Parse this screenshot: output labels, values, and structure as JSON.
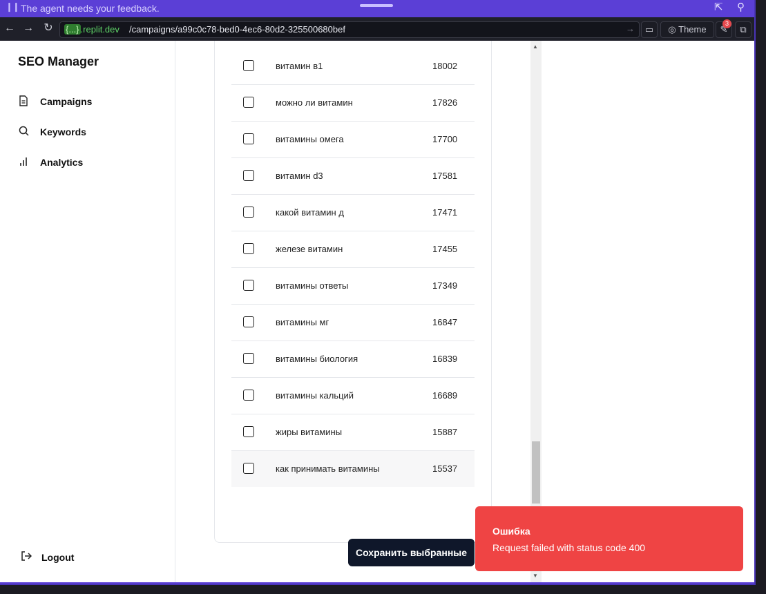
{
  "banner": {
    "message": "The agent needs your feedback."
  },
  "browser": {
    "domain_braces": "{...}",
    "domain": ".replit.dev",
    "path": "/campaigns/a99c0c78-bed0-4ec6-80d2-325500680bef",
    "theme_label": "Theme",
    "notification_count": "3"
  },
  "sidebar": {
    "app_title": "SEO Manager",
    "items": [
      {
        "label": "Campaigns",
        "icon": "file-text-icon"
      },
      {
        "label": "Keywords",
        "icon": "search-icon"
      },
      {
        "label": "Analytics",
        "icon": "bar-chart-icon"
      }
    ],
    "logout_label": "Logout"
  },
  "keywords": [
    {
      "keyword": "витамин в1",
      "volume": "18002"
    },
    {
      "keyword": "можно ли витамин",
      "volume": "17826"
    },
    {
      "keyword": "витамины омега",
      "volume": "17700"
    },
    {
      "keyword": "витамин d3",
      "volume": "17581"
    },
    {
      "keyword": "какой витамин д",
      "volume": "17471"
    },
    {
      "keyword": "железе витамин",
      "volume": "17455"
    },
    {
      "keyword": "витамины ответы",
      "volume": "17349"
    },
    {
      "keyword": "витамины мг",
      "volume": "16847"
    },
    {
      "keyword": "витамины биология",
      "volume": "16839"
    },
    {
      "keyword": "витамины кальций",
      "volume": "16689"
    },
    {
      "keyword": "жиры витамины",
      "volume": "15887"
    },
    {
      "keyword": "как принимать витамины",
      "volume": "15537"
    }
  ],
  "save_button_label": "Сохранить выбранные",
  "toast": {
    "title": "Ошибка",
    "description": "Request failed with status code 400",
    "color": "#ef4444"
  }
}
